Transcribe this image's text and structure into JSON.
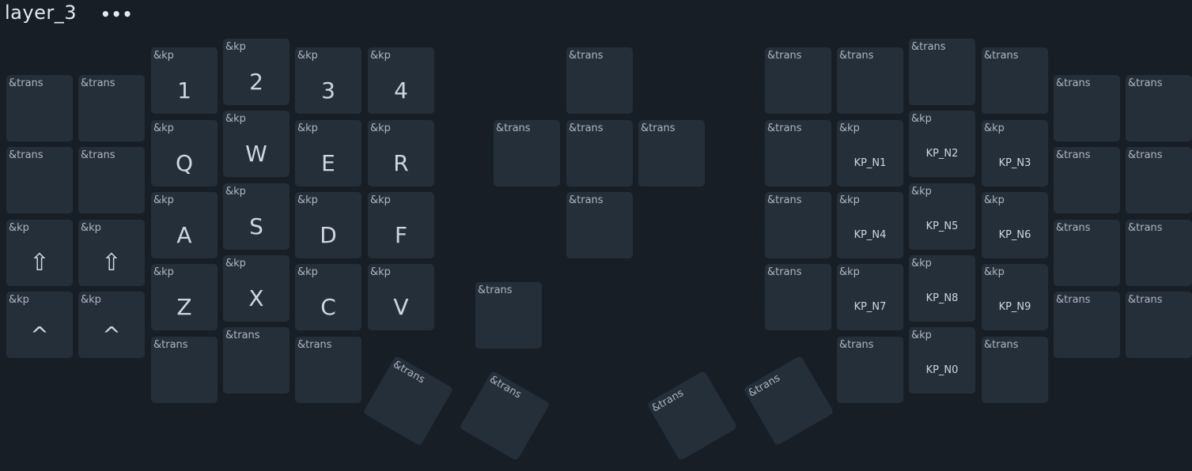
{
  "layer": {
    "name": "layer_3",
    "more_label": "•••"
  },
  "keys": [
    {
      "name": "L0",
      "label": "&trans",
      "legend": ""
    },
    {
      "name": "L1",
      "label": "&trans",
      "legend": ""
    },
    {
      "name": "L2",
      "label": "&kp",
      "legend": "1"
    },
    {
      "name": "L3",
      "label": "&kp",
      "legend": "2"
    },
    {
      "name": "L4",
      "label": "&kp",
      "legend": "3"
    },
    {
      "name": "L5",
      "label": "&kp",
      "legend": "4"
    },
    {
      "name": "L6",
      "label": "&trans",
      "legend": ""
    },
    {
      "name": "L7",
      "label": "&trans",
      "legend": ""
    },
    {
      "name": "L8",
      "label": "&kp",
      "legend": "Q"
    },
    {
      "name": "L9",
      "label": "&kp",
      "legend": "W"
    },
    {
      "name": "L10",
      "label": "&kp",
      "legend": "E"
    },
    {
      "name": "L11",
      "label": "&kp",
      "legend": "R"
    },
    {
      "name": "L12",
      "label": "&kp",
      "legend": "⇧"
    },
    {
      "name": "L13",
      "label": "&kp",
      "legend": "⇧"
    },
    {
      "name": "L14",
      "label": "&kp",
      "legend": "A"
    },
    {
      "name": "L15",
      "label": "&kp",
      "legend": "S"
    },
    {
      "name": "L16",
      "label": "&kp",
      "legend": "D"
    },
    {
      "name": "L17",
      "label": "&kp",
      "legend": "F"
    },
    {
      "name": "L18",
      "label": "&kp",
      "legend": "^"
    },
    {
      "name": "L19",
      "label": "&kp",
      "legend": "^"
    },
    {
      "name": "L20",
      "label": "&kp",
      "legend": "Z"
    },
    {
      "name": "L21",
      "label": "&kp",
      "legend": "X"
    },
    {
      "name": "L22",
      "label": "&kp",
      "legend": "C"
    },
    {
      "name": "L23",
      "label": "&kp",
      "legend": "V"
    },
    {
      "name": "L24",
      "label": "&trans",
      "legend": ""
    },
    {
      "name": "L25",
      "label": "&trans",
      "legend": ""
    },
    {
      "name": "L26",
      "label": "&trans",
      "legend": ""
    },
    {
      "name": "LT0",
      "label": "&trans",
      "legend": ""
    },
    {
      "name": "LT1",
      "label": "&trans",
      "legend": ""
    },
    {
      "name": "M0",
      "label": "&trans",
      "legend": ""
    },
    {
      "name": "M1",
      "label": "&trans",
      "legend": ""
    },
    {
      "name": "M2",
      "label": "&trans",
      "legend": ""
    },
    {
      "name": "M3",
      "label": "&trans",
      "legend": ""
    },
    {
      "name": "M4",
      "label": "&trans",
      "legend": ""
    },
    {
      "name": "M5",
      "label": "&trans",
      "legend": ""
    },
    {
      "name": "RT0",
      "label": "&trans",
      "legend": ""
    },
    {
      "name": "RT1",
      "label": "&trans",
      "legend": ""
    },
    {
      "name": "R0",
      "label": "&trans",
      "legend": ""
    },
    {
      "name": "R1",
      "label": "&trans",
      "legend": ""
    },
    {
      "name": "R2",
      "label": "&trans",
      "legend": ""
    },
    {
      "name": "R3",
      "label": "&trans",
      "legend": ""
    },
    {
      "name": "R4",
      "label": "&trans",
      "legend": ""
    },
    {
      "name": "R5",
      "label": "&trans",
      "legend": ""
    },
    {
      "name": "R6",
      "label": "&trans",
      "legend": ""
    },
    {
      "name": "R7",
      "label": "&kp",
      "legend": "KP_N1"
    },
    {
      "name": "R8",
      "label": "&kp",
      "legend": "KP_N2"
    },
    {
      "name": "R9",
      "label": "&kp",
      "legend": "KP_N3"
    },
    {
      "name": "R10",
      "label": "&trans",
      "legend": ""
    },
    {
      "name": "R11",
      "label": "&trans",
      "legend": ""
    },
    {
      "name": "R12",
      "label": "&trans",
      "legend": ""
    },
    {
      "name": "R13",
      "label": "&kp",
      "legend": "KP_N4"
    },
    {
      "name": "R14",
      "label": "&kp",
      "legend": "KP_N5"
    },
    {
      "name": "R15",
      "label": "&kp",
      "legend": "KP_N6"
    },
    {
      "name": "R16",
      "label": "&trans",
      "legend": ""
    },
    {
      "name": "R17",
      "label": "&trans",
      "legend": ""
    },
    {
      "name": "R18",
      "label": "&trans",
      "legend": ""
    },
    {
      "name": "R19",
      "label": "&kp",
      "legend": "KP_N7"
    },
    {
      "name": "R20",
      "label": "&kp",
      "legend": "KP_N8"
    },
    {
      "name": "R21",
      "label": "&kp",
      "legend": "KP_N9"
    },
    {
      "name": "R22",
      "label": "&trans",
      "legend": ""
    },
    {
      "name": "R23",
      "label": "&trans",
      "legend": ""
    },
    {
      "name": "R24",
      "label": "&trans",
      "legend": ""
    },
    {
      "name": "R25",
      "label": "&kp",
      "legend": "KP_N0"
    },
    {
      "name": "R26",
      "label": "&trans",
      "legend": ""
    }
  ]
}
